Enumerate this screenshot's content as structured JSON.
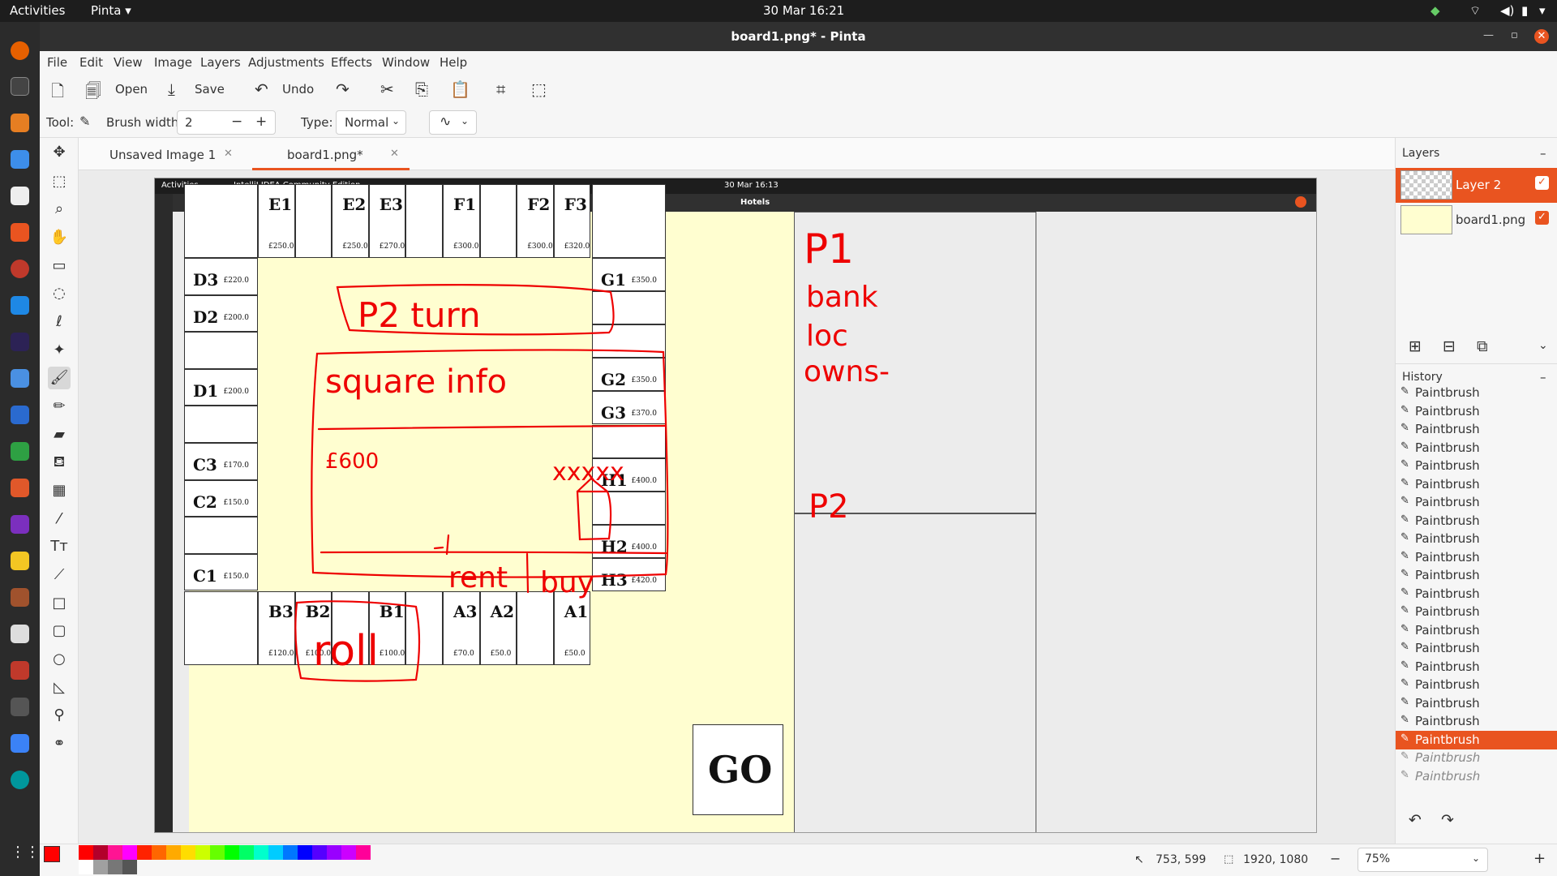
{
  "topbar": {
    "activities": "Activities",
    "app": "Pinta",
    "clock": "30 Mar  16:21"
  },
  "window": {
    "title": "board1.png* - Pinta"
  },
  "menu": [
    "File",
    "Edit",
    "View",
    "Image",
    "Layers",
    "Adjustments",
    "Effects",
    "Window",
    "Help"
  ],
  "toolbar": {
    "open": "Open",
    "save": "Save",
    "undo": "Undo"
  },
  "options": {
    "tool_label": "Tool:",
    "brush_width_label": "Brush width:",
    "brush_width": "2",
    "type_label": "Type:",
    "type_value": "Normal"
  },
  "tabs": [
    {
      "label": "Unsaved Image 1"
    },
    {
      "label": "board1.png*"
    }
  ],
  "layers": {
    "header": "Layers",
    "items": [
      {
        "name": "Layer 2",
        "active": true
      },
      {
        "name": "board1.png",
        "active": false
      }
    ]
  },
  "history": {
    "header": "History",
    "items": [
      "Paintbrush",
      "Paintbrush",
      "Paintbrush",
      "Paintbrush",
      "Paintbrush",
      "Paintbrush",
      "Paintbrush",
      "Paintbrush",
      "Paintbrush",
      "Paintbrush",
      "Paintbrush",
      "Paintbrush",
      "Paintbrush",
      "Paintbrush",
      "Paintbrush",
      "Paintbrush",
      "Paintbrush",
      "Paintbrush",
      "Paintbrush",
      "Paintbrush",
      "Paintbrush",
      "Paintbrush"
    ],
    "selected_index": 19
  },
  "status": {
    "cursor": "753, 599",
    "size": "1920, 1080",
    "zoom": "75%"
  },
  "palette": [
    "#ff0000",
    "#b3002a",
    "#ff1493",
    "#ff00ff",
    "#ffffff",
    "#a0a0a0",
    "#777777",
    "#555555",
    "#ff2200",
    "#ff6600",
    "#ffaa00",
    "#ffdd00",
    "#ccff00",
    "#66ff00",
    "#00ff00",
    "#00ff66",
    "#00ffcc",
    "#00ccff",
    "#0077ff",
    "#0000ff",
    "#5500ff",
    "#9900ff",
    "#cc00ff",
    "#ff0099"
  ],
  "inner": {
    "activities": "Activities",
    "app": "IntelliJ IDEA Community Edition",
    "clock": "30 Mar  16:13",
    "title": "Hotels",
    "top_row": [
      {
        "name": "E1",
        "price": "£250.0"
      },
      {
        "name": "",
        "price": ""
      },
      {
        "name": "E2",
        "price": "£250.0"
      },
      {
        "name": "E3",
        "price": "£270.0"
      },
      {
        "name": "",
        "price": ""
      },
      {
        "name": "F1",
        "price": "£300.0"
      },
      {
        "name": "",
        "price": ""
      },
      {
        "name": "F2",
        "price": "£300.0"
      },
      {
        "name": "F3",
        "price": "£320.0"
      }
    ],
    "bottom_row": [
      {
        "name": "B3",
        "price": "£120.0"
      },
      {
        "name": "B2",
        "price": "£100.0"
      },
      {
        "name": "",
        "price": ""
      },
      {
        "name": "B1",
        "price": "£100.0"
      },
      {
        "name": "",
        "price": ""
      },
      {
        "name": "A3",
        "price": "£70.0"
      },
      {
        "name": "A2",
        "price": "£50.0"
      },
      {
        "name": "",
        "price": ""
      },
      {
        "name": "A1",
        "price": "£50.0"
      }
    ],
    "left_col": [
      {
        "name": "D3",
        "price": "£220.0"
      },
      {
        "name": "D2",
        "price": "£200.0"
      },
      {
        "name": "",
        "price": ""
      },
      {
        "name": "D1",
        "price": "£200.0"
      },
      {
        "name": "",
        "price": ""
      },
      {
        "name": "C3",
        "price": "£170.0"
      },
      {
        "name": "C2",
        "price": "£150.0"
      },
      {
        "name": "",
        "price": ""
      },
      {
        "name": "C1",
        "price": "£150.0"
      }
    ],
    "right_col": [
      {
        "name": "G1",
        "price": "£350.0"
      },
      {
        "name": "",
        "price": ""
      },
      {
        "name": "",
        "price": ""
      },
      {
        "name": "G2",
        "price": "£350.0"
      },
      {
        "name": "G3",
        "price": "£370.0"
      },
      {
        "name": "",
        "price": ""
      },
      {
        "name": "H1",
        "price": "£400.0"
      },
      {
        "name": "",
        "price": ""
      },
      {
        "name": "H2",
        "price": "£400.0"
      },
      {
        "name": "H3",
        "price": "£420.0"
      }
    ],
    "go": "GO",
    "sketch": {
      "p2_turn": "P2 turn",
      "square_info": "square info",
      "price": "£600",
      "crosses": "xxxxx",
      "rent": "rent",
      "buy": "buy",
      "roll": "roll",
      "p1": "P1",
      "bank": "bank",
      "loc": "loc",
      "owns": "owns-",
      "p2": "P2"
    }
  }
}
